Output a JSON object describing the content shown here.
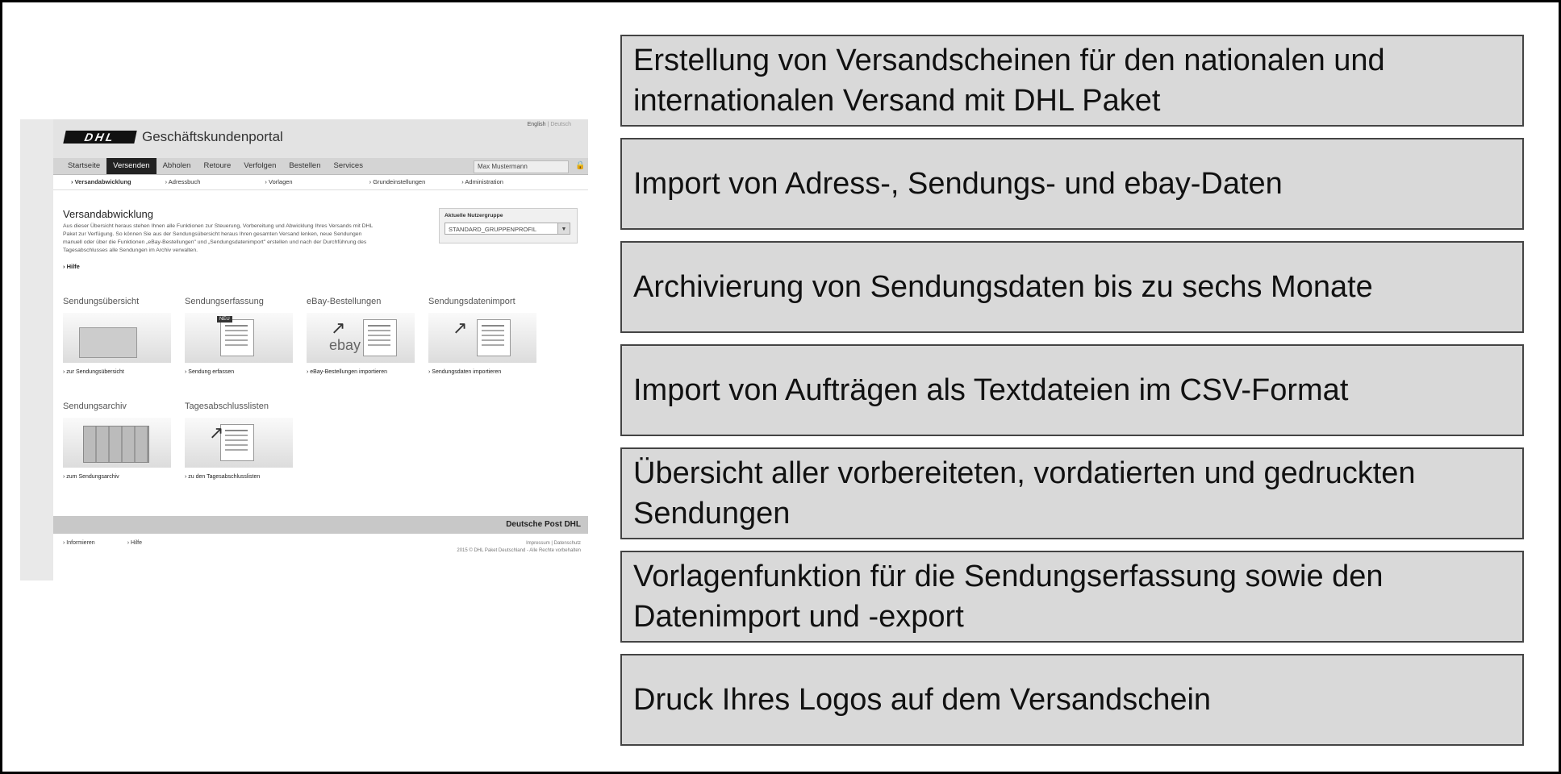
{
  "portal": {
    "logo": "DHL",
    "title": "Geschäftskundenportal",
    "lang_english": "English",
    "lang_separator": "|",
    "lang_deutsch": "Deutsch",
    "nav": [
      "Startseite",
      "Versenden",
      "Abholen",
      "Retoure",
      "Verfolgen",
      "Bestellen",
      "Services"
    ],
    "active_nav": "Versenden",
    "user": "Max Mustermann",
    "subnav": [
      "Versandabwicklung",
      "Adressbuch",
      "Vorlagen",
      "Grundeinstellungen",
      "Administration"
    ],
    "section_title": "Versandabwicklung",
    "intro": "Aus dieser Übersicht heraus stehen Ihnen alle Funktionen zur Steuerung, Vorbereitung und Abwicklung Ihres Versands mit DHL Paket zur Verfügung. So können Sie aus der Sendungsübersicht heraus Ihren gesamten Versand lenken, neue Sendungen manuell oder über die Funktionen „eBay-Bestellungen\" und „Sendungsdatenimport\" erstellen und nach der Durchführung des Tagesabschlusses alle Sendungen im Archiv verwalten.",
    "hilfe": "Hilfe",
    "group_label": "Aktuelle Nutzergruppe",
    "group_value": "STANDARD_GRUPPENPROFIL",
    "tiles": [
      {
        "title": "Sendungsübersicht",
        "link": "zur Sendungsübersicht"
      },
      {
        "title": "Sendungserfassung",
        "link": "Sendung erfassen",
        "badge": "NEU"
      },
      {
        "title": "eBay-Bestellungen",
        "link": "eBay-Bestellungen importieren",
        "logo": "ebay"
      },
      {
        "title": "Sendungsdatenimport",
        "link": "Sendungsdaten importieren"
      },
      {
        "title": "Sendungsarchiv",
        "link": "zum Sendungsarchiv"
      },
      {
        "title": "Tagesabschlusslisten",
        "link": "zu den Tagesabschlusslisten"
      }
    ],
    "brand": "Deutsche Post DHL",
    "footer_links": [
      "Informieren",
      "Hilfe"
    ],
    "footer_right_1": "Impressum  |  Datenschutz",
    "footer_right_2": "2015 © DHL Paket Deutschland - Alle Rechte vorbehalten"
  },
  "features": [
    "Erstellung von Versandscheinen für den nationalen und internationalen Versand mit DHL Paket",
    "Import von Adress-, Sendungs- und ebay-Daten",
    "Archivierung von Sendungsdaten bis zu sechs Monate",
    "Import von Aufträgen als Textdateien im CSV-Format",
    "Übersicht aller vorbereiteten, vordatierten und gedruckten Sendungen",
    "Vorlagenfunktion für die Sendungserfassung sowie den Datenimport und -export",
    "Druck Ihres Logos auf dem Versandschein"
  ]
}
